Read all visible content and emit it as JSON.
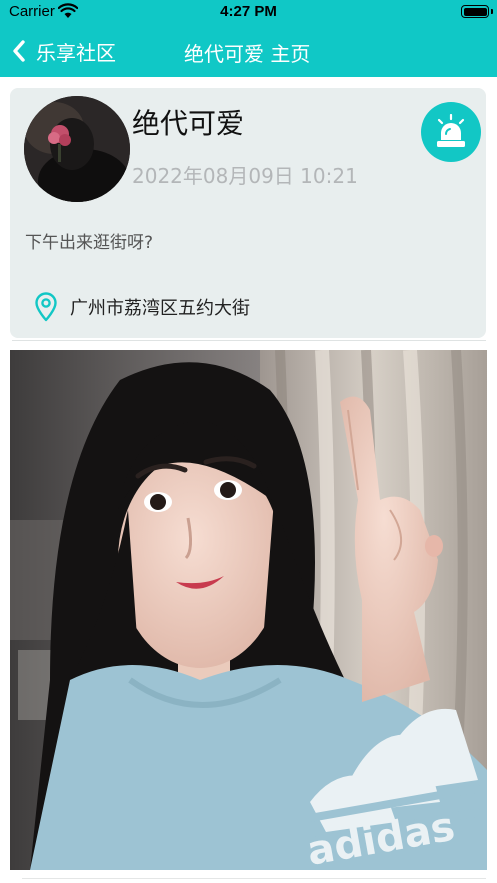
{
  "status_bar": {
    "carrier": "Carrier",
    "time": "4:27 PM"
  },
  "nav": {
    "back_label": "乐享社区",
    "title": "绝代可爱 主页"
  },
  "post": {
    "username": "绝代可爱",
    "datetime": "2022年08月09日  10:21",
    "text": "下午出来逛街呀?",
    "location": "广州市荔湾区五约大街"
  },
  "icons": {
    "back": "chevron-left-icon",
    "report": "alarm-siren-icon",
    "location": "location-pin-icon",
    "wifi": "wifi-icon",
    "battery": "battery-icon"
  },
  "colors": {
    "accent": "#10c8c6",
    "card": "#e8eeee",
    "time_text": "#b3b6b8"
  }
}
